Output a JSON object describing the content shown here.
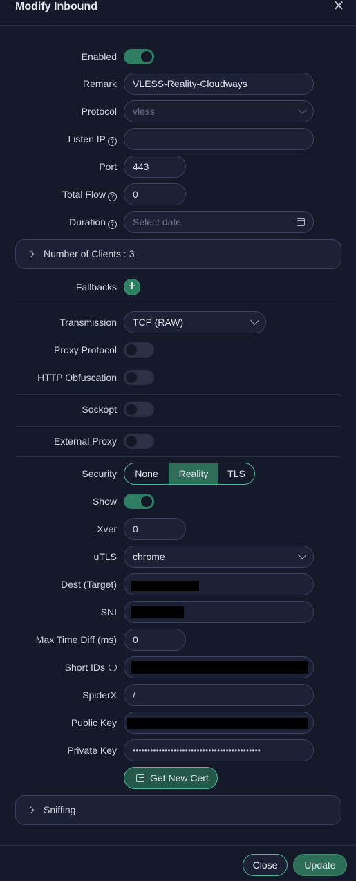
{
  "dialog": {
    "title": "Modify Inbound"
  },
  "form": {
    "enabled_label": "Enabled",
    "remark_label": "Remark",
    "remark_value": "VLESS-Reality-Cloudways",
    "protocol_label": "Protocol",
    "protocol_value": "vless",
    "listen_ip_label": "Listen IP",
    "listen_ip_value": "",
    "port_label": "Port",
    "port_value": "443",
    "total_flow_label": "Total Flow",
    "total_flow_value": "0",
    "duration_label": "Duration",
    "duration_placeholder": "Select date",
    "clients_label": "Number of Clients : 3",
    "fallbacks_label": "Fallbacks",
    "fallbacks_add": "+",
    "transmission_label": "Transmission",
    "transmission_value": "TCP (RAW)",
    "proxy_protocol_label": "Proxy Protocol",
    "http_obfuscation_label": "HTTP Obfuscation",
    "sockopt_label": "Sockopt",
    "external_proxy_label": "External Proxy",
    "security_label": "Security",
    "security_options": [
      "None",
      "Reality",
      "TLS"
    ],
    "security_selected": "Reality",
    "show_label": "Show",
    "xver_label": "Xver",
    "xver_value": "0",
    "utls_label": "uTLS",
    "utls_value": "chrome",
    "dest_label": "Dest (Target)",
    "sni_label": "SNI",
    "max_time_diff_label": "Max Time Diff (ms)",
    "max_time_diff_value": "0",
    "short_ids_label": "Short IDs",
    "spiderx_label": "SpiderX",
    "spiderx_value": "/",
    "public_key_label": "Public Key",
    "private_key_label": "Private Key",
    "private_key_value": "••••••••••••••••••••••••••••••••••••••••••••",
    "get_new_cert_label": "Get New Cert",
    "sniffing_label": "Sniffing"
  },
  "toggles": {
    "enabled": true,
    "proxy_protocol": false,
    "http_obfuscation": false,
    "sockopt": false,
    "external_proxy": false,
    "show": true
  },
  "footer": {
    "close_label": "Close",
    "update_label": "Update"
  },
  "colors": {
    "background": "#151a2b",
    "accent": "#2f7d63",
    "accent_border": "#58b79a"
  }
}
